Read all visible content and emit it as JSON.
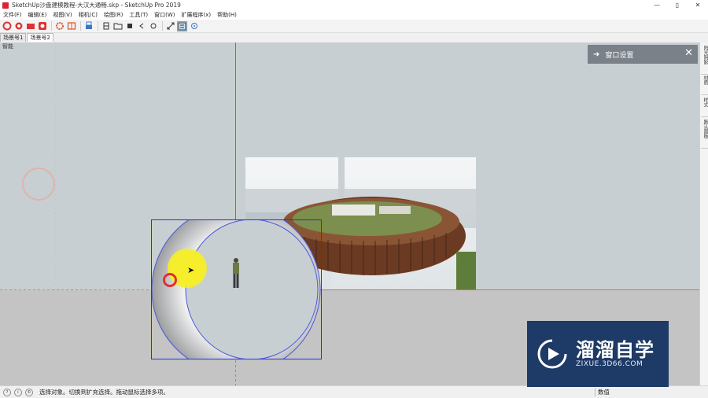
{
  "window": {
    "title": "SketchUp沙盘建模教程-大汉大通畅.skp - SketchUp Pro 2019",
    "minimize": "—",
    "maximize": "▯",
    "close": "✕"
  },
  "menu": [
    "文件(F)",
    "编辑(E)",
    "视图(V)",
    "相机(C)",
    "绘图(R)",
    "工具(T)",
    "窗口(W)",
    "扩展程序(x)",
    "帮助(H)"
  ],
  "scenes": [
    "场景号1",
    "场景号2"
  ],
  "viewport": {
    "label": "智能"
  },
  "panel": {
    "title": "窗口设置"
  },
  "right_tray": [
    "阳光阴影",
    "材质",
    "样式",
    "默认面板"
  ],
  "status": {
    "message": "选择对象。切换到扩充选择。拖动鼠标选择多项。",
    "measure_label": "数值"
  },
  "watermark": {
    "title": "溜溜自学",
    "url": "ZIXUE.3D66.COM"
  },
  "colors": {
    "sky": "#c7cfd2",
    "ground": "#c4c4c4",
    "blue_axis": "#5a6ee0",
    "red_axis": "#d07070",
    "selection": "#2233dd",
    "panel_bg": "#7b8188",
    "watermark_bg": "#1e3a66"
  }
}
